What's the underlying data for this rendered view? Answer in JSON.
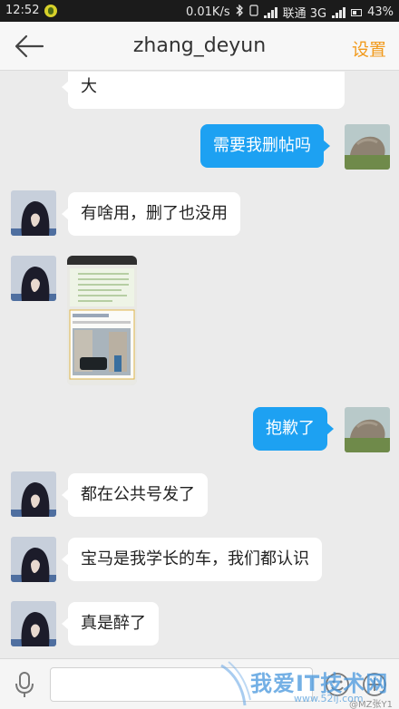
{
  "status_bar": {
    "time": "12:52",
    "speed": "0.01K/s",
    "carrier": "联通 3G",
    "battery": "43%"
  },
  "header": {
    "title": "zhang_deyun",
    "settings_label": "设置"
  },
  "messages": [
    {
      "side": "in",
      "text": "大"
    },
    {
      "side": "out",
      "text": "需要我删帖吗"
    },
    {
      "side": "in",
      "text": "有啥用，删了也没用"
    },
    {
      "side": "in",
      "type": "image"
    },
    {
      "side": "out",
      "text": "抱歉了"
    },
    {
      "side": "in",
      "text": "都在公共号发了"
    },
    {
      "side": "in",
      "text": "宝马是我学长的车，我们都认识"
    },
    {
      "side": "in",
      "text": "真是醉了"
    }
  ],
  "watermark": {
    "text": "我爱IT技术网",
    "url": "www.52ij.com",
    "tag": "@MZ张Y1"
  },
  "icons": [
    "back-arrow-icon",
    "microphone-icon",
    "emoji-icon",
    "plus-icon",
    "bluetooth-icon",
    "signal-icon",
    "battery-icon"
  ],
  "colors": {
    "outgoing_bubble": "#1da1f2",
    "settings_accent": "#f19a1c"
  }
}
